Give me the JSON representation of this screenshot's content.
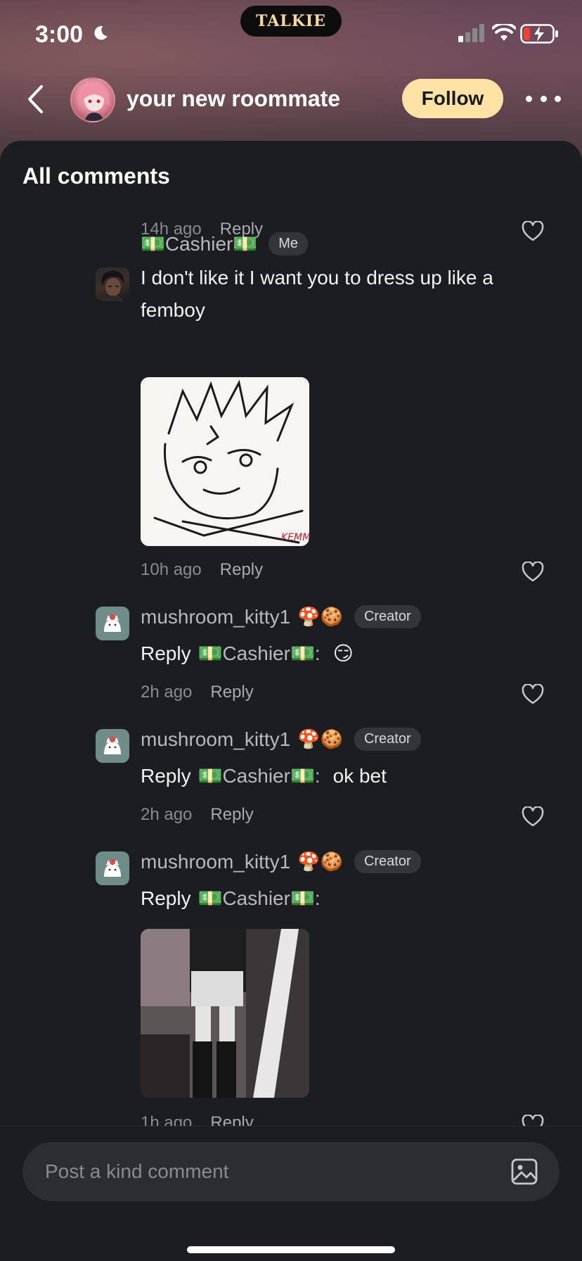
{
  "status_bar": {
    "time": "3:00",
    "notch_logo": "TALKIE"
  },
  "nav": {
    "title": "your new roommate",
    "follow_label": "Follow"
  },
  "sheet": {
    "title": "All comments"
  },
  "comments": [
    {
      "time": "14h ago",
      "reply_label": "Reply"
    },
    {
      "username": "💵Cashier💵",
      "badge": "Me",
      "text": "I don't like it I want you to dress up like a femboy",
      "time": "10h ago",
      "reply_label": "Reply"
    },
    {
      "username": "mushroom_kitty1",
      "emojis": "🍄🍪",
      "badge": "Creator",
      "reply_prefix": "Reply",
      "mention": "💵Cashier💵",
      "colon": ":",
      "body": "😏",
      "time": "2h ago",
      "reply_label": "Reply"
    },
    {
      "username": "mushroom_kitty1",
      "emojis": "🍄🍪",
      "badge": "Creator",
      "reply_prefix": "Reply",
      "mention": "💵Cashier💵",
      "colon": ":",
      "body": "ok bet",
      "time": "2h ago",
      "reply_label": "Reply"
    },
    {
      "username": "mushroom_kitty1",
      "emojis": "🍄🍪",
      "badge": "Creator",
      "reply_prefix": "Reply",
      "mention": "💵Cashier💵",
      "colon": ":",
      "time": "1h ago",
      "reply_label": "Reply"
    }
  ],
  "composer": {
    "placeholder": "Post a kind comment"
  },
  "colors": {
    "follow_bg": "#ffe3a6",
    "sheet_bg": "#1c1d21",
    "badge_bg": "#34353a"
  }
}
